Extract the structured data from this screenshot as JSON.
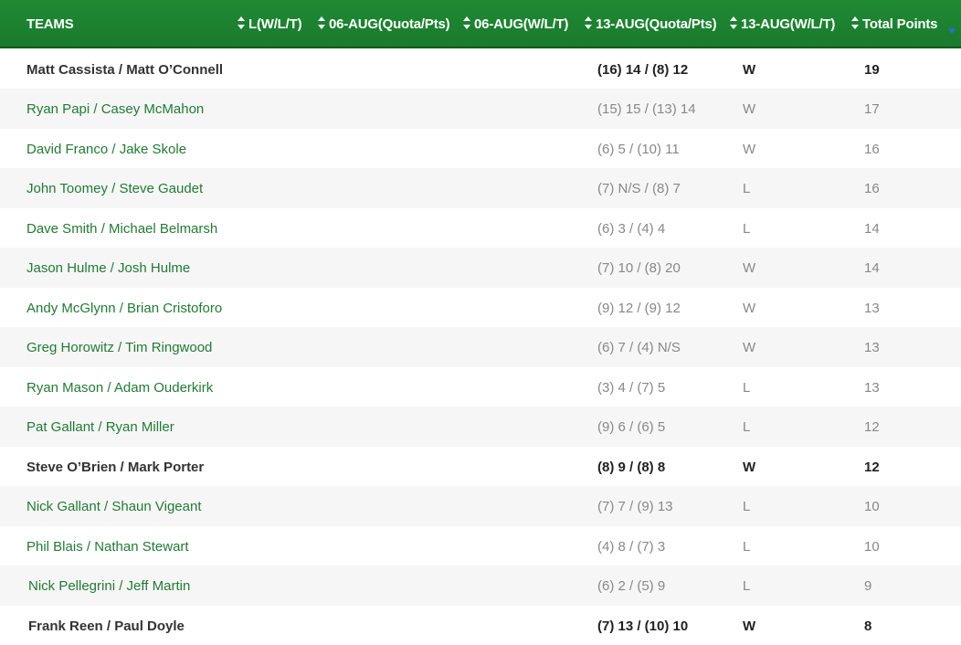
{
  "headers": {
    "teams": "TEAMS",
    "col2": "L(W/L/T)",
    "col3": "06-AUG(Quota/Pts)",
    "col4": "06-AUG(W/L/T)",
    "col5": "13-AUG(Quota/Pts)",
    "col6": "13-AUG(W/L/T)",
    "total": "Total Points"
  },
  "colors": {
    "header_green": "#1f8a34",
    "team_link": "#237a35",
    "sort_active": "#2a6dd9"
  },
  "rows": [
    {
      "team": "Matt Cassista / Matt O’Connell",
      "quota": "(16) 14 / (8) 12",
      "wlt": "W",
      "pts": "19",
      "bold": true
    },
    {
      "team": "Ryan Papi / Casey McMahon",
      "quota": "(15) 15 / (13) 14",
      "wlt": "W",
      "pts": "17",
      "bold": false
    },
    {
      "team": "David Franco / Jake Skole",
      "quota": "(6) 5 / (10) 11",
      "wlt": "W",
      "pts": "16",
      "bold": false
    },
    {
      "team": "John Toomey / Steve Gaudet",
      "quota": "(7) N/S / (8) 7",
      "wlt": "L",
      "pts": "16",
      "bold": false
    },
    {
      "team": "Dave Smith / Michael Belmarsh",
      "quota": "(6) 3 / (4) 4",
      "wlt": "L",
      "pts": "14",
      "bold": false
    },
    {
      "team": "Jason Hulme / Josh Hulme",
      "quota": "(7) 10 / (8) 20",
      "wlt": "W",
      "pts": "14",
      "bold": false
    },
    {
      "team": "Andy McGlynn / Brian Cristoforo",
      "quota": "(9) 12 / (9) 12",
      "wlt": "W",
      "pts": "13",
      "bold": false
    },
    {
      "team": "Greg Horowitz / Tim Ringwood",
      "quota": "(6) 7 / (4) N/S",
      "wlt": "W",
      "pts": "13",
      "bold": false
    },
    {
      "team": "Ryan Mason / Adam Ouderkirk",
      "quota": "(3) 4 / (7) 5",
      "wlt": "L",
      "pts": "13",
      "bold": false
    },
    {
      "team": "Pat Gallant / Ryan Miller",
      "quota": "(9) 6 / (6) 5",
      "wlt": "L",
      "pts": "12",
      "bold": false
    },
    {
      "team": "Steve O’Brien / Mark Porter",
      "quota": "(8) 9 / (8) 8",
      "wlt": "W",
      "pts": "12",
      "bold": true
    },
    {
      "team": "Nick Gallant / Shaun Vigeant",
      "quota": "(7) 7 / (9) 13",
      "wlt": "L",
      "pts": "10",
      "bold": false
    },
    {
      "team": "Phil Blais / Nathan Stewart",
      "quota": "(4) 8 / (7) 3",
      "wlt": "L",
      "pts": "10",
      "bold": false
    },
    {
      "team": "Nick Pellegrini / Jeff Martin",
      "quota": "(6) 2 / (5) 9",
      "wlt": "L",
      "pts": "9",
      "bold": false
    },
    {
      "team": "Frank Reen / Paul Doyle",
      "quota": "(7) 13 / (10) 10",
      "wlt": "W",
      "pts": "8",
      "bold": true
    }
  ]
}
